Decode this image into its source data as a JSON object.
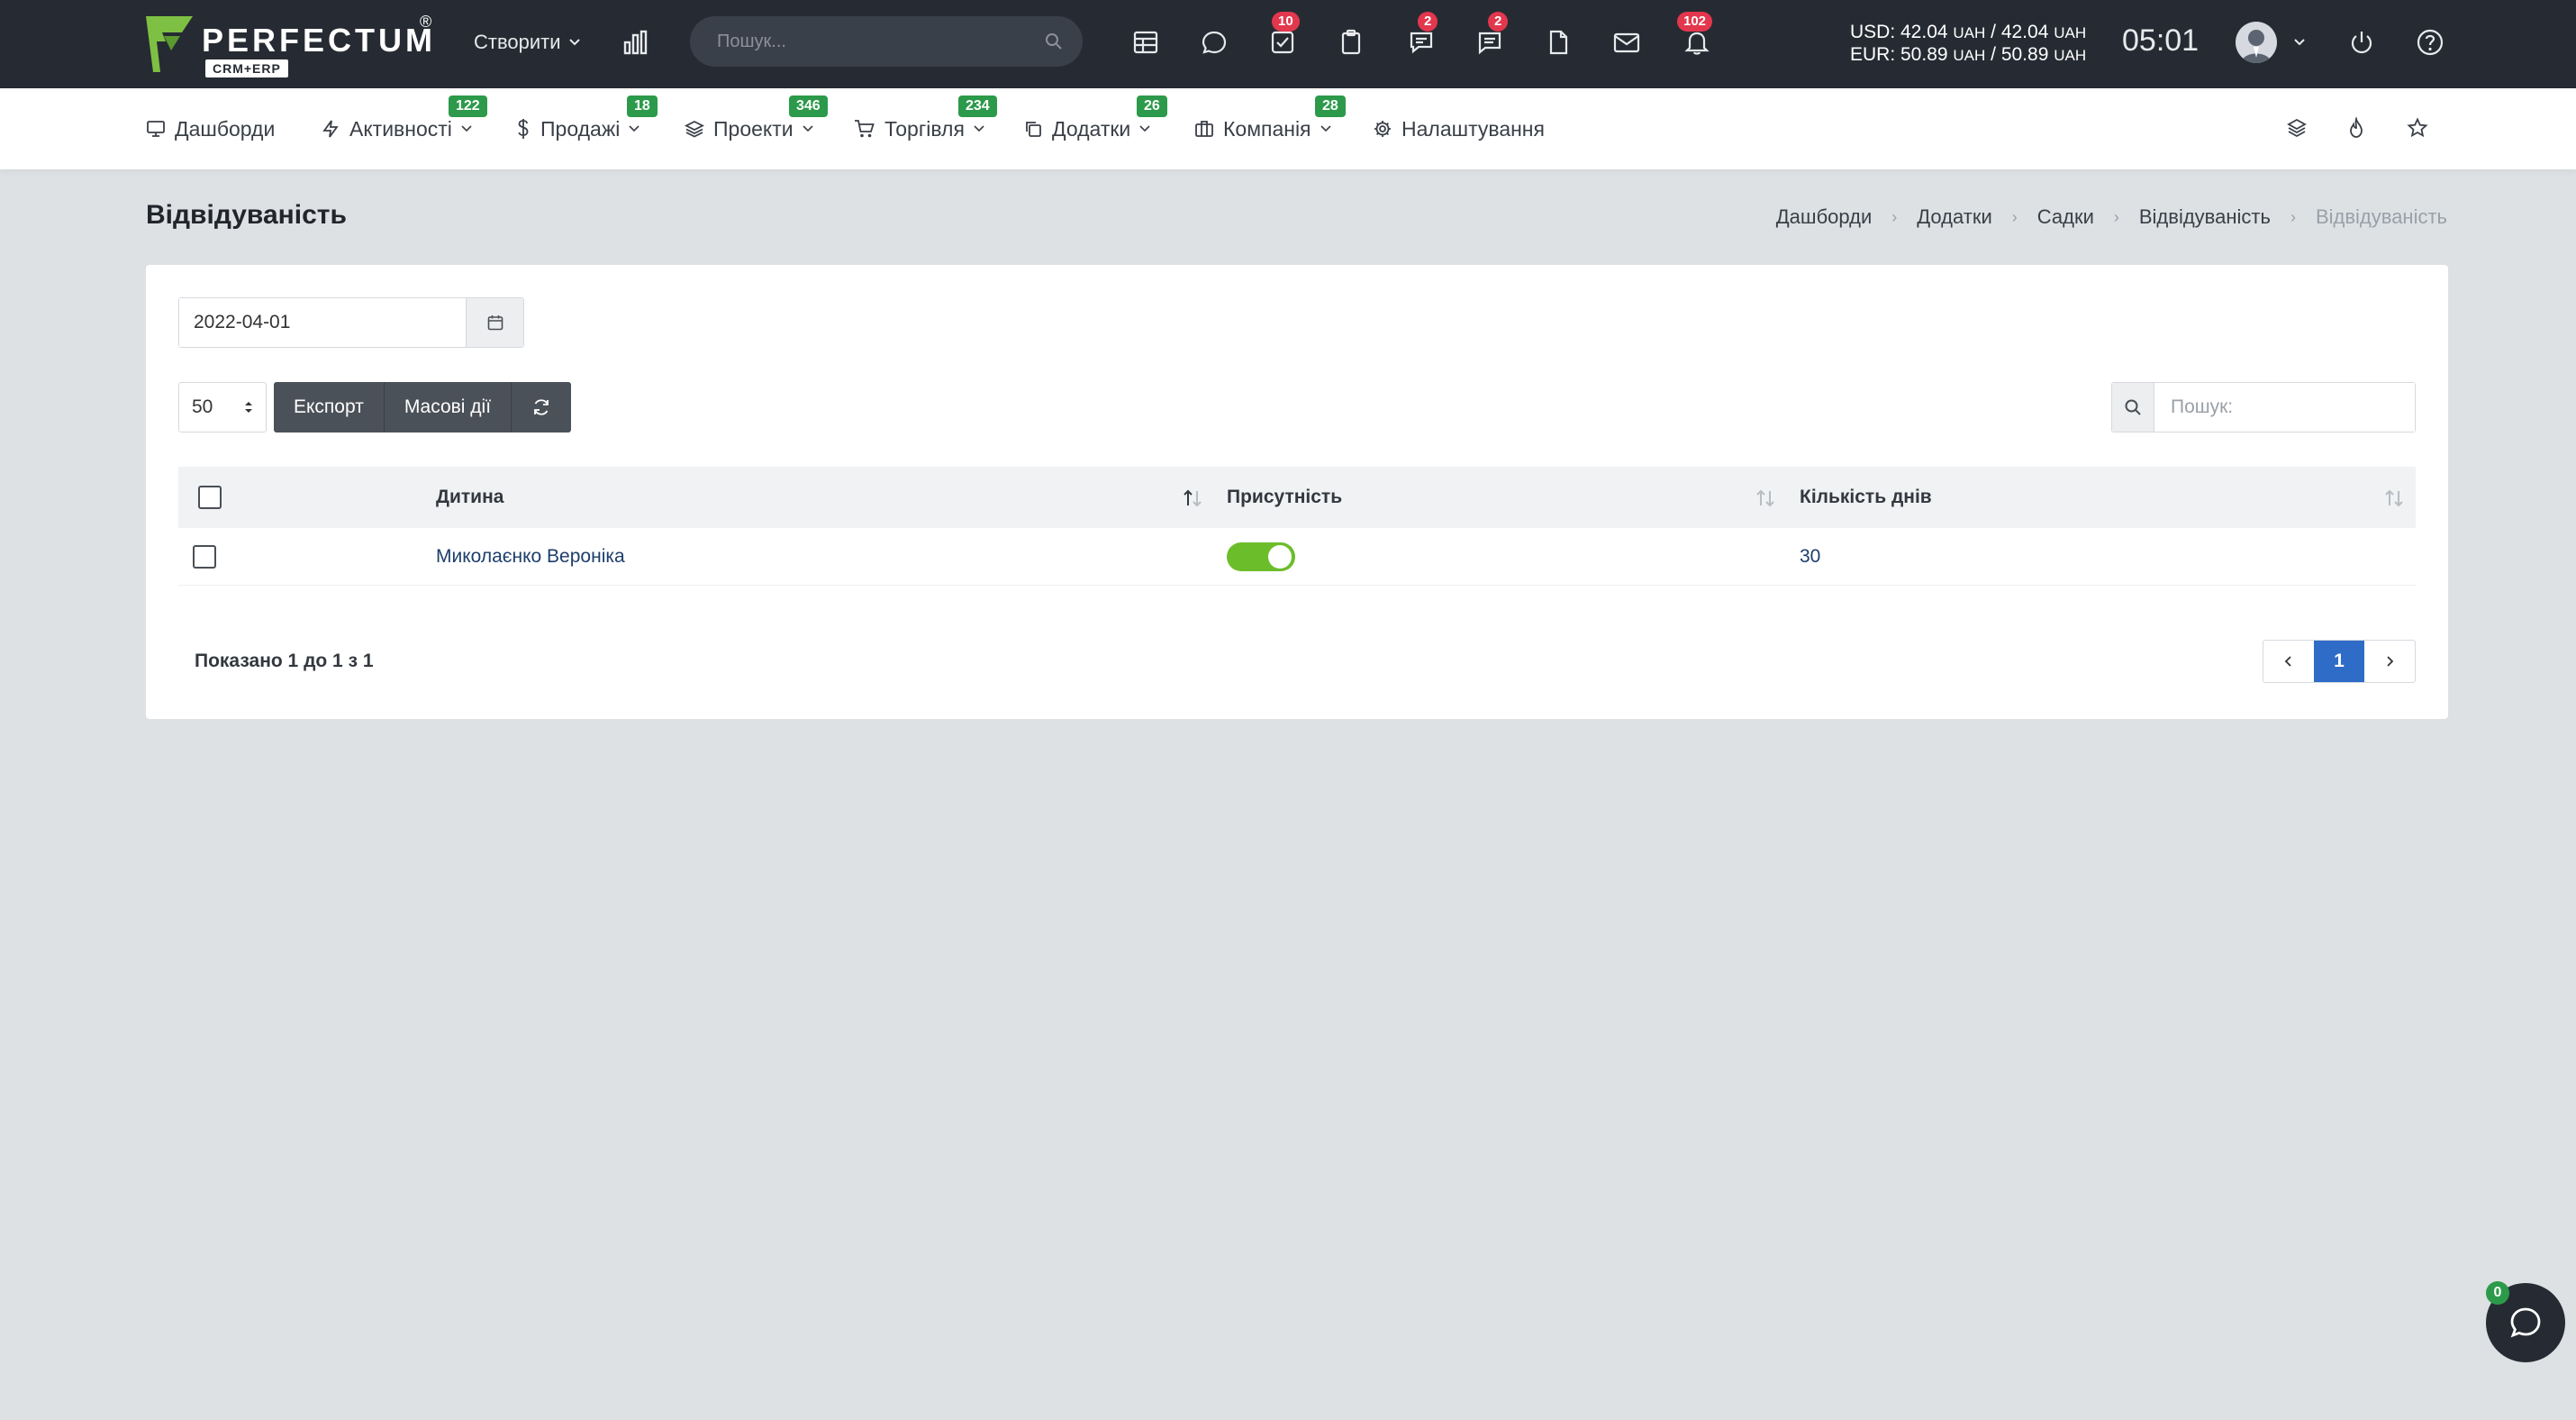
{
  "topbar": {
    "brand": "PERFECTUM",
    "brand_reg": "®",
    "brand_sub": "CRM+ERP",
    "create_label": "Створити",
    "search_placeholder": "Пошук...",
    "badges": {
      "tasks": "10",
      "chat": "2",
      "comments": "2",
      "notifications": "102"
    },
    "currency": {
      "usd_label": "USD: 42.04",
      "usd_unit1": "UAH",
      "usd_sep": " / 42.04",
      "usd_unit2": "UAH",
      "eur_label": "EUR: 50.89",
      "eur_unit1": "UAH",
      "eur_sep": " / 50.89",
      "eur_unit2": "UAH"
    },
    "time": "05:01"
  },
  "menu": {
    "items": [
      {
        "label": "Дашборди",
        "badge": ""
      },
      {
        "label": "Активності",
        "badge": "122"
      },
      {
        "label": "Продажі",
        "badge": "18"
      },
      {
        "label": "Проекти",
        "badge": "346"
      },
      {
        "label": "Торгівля",
        "badge": "234"
      },
      {
        "label": "Додатки",
        "badge": "26"
      },
      {
        "label": "Компанія",
        "badge": "28"
      },
      {
        "label": "Налаштування",
        "badge": ""
      }
    ]
  },
  "page": {
    "title": "Відвідуваність",
    "breadcrumb": [
      "Дашборди",
      "Додатки",
      "Садки",
      "Відвідуваність",
      "Відвідуваність"
    ]
  },
  "filters": {
    "date": "2022-04-01",
    "per_page": "50",
    "export_label": "Експорт",
    "bulk_label": "Масові дії",
    "search_placeholder": "Пошук:"
  },
  "table": {
    "columns": [
      "Дитина",
      "Присутність",
      "Кількість днів"
    ],
    "rows": [
      {
        "child": "Миколаєнко Вероніка",
        "present": true,
        "days": "30"
      }
    ]
  },
  "footer": {
    "info": "Показано 1 до 1 з 1",
    "current_page": "1"
  },
  "chat": {
    "badge": "0"
  },
  "colors": {
    "topbar": "#262b33",
    "accent_green": "#2c9a4a",
    "badge_red": "#e3374d",
    "toggle_on": "#6cbd2a",
    "page_active": "#2f6cc8"
  }
}
